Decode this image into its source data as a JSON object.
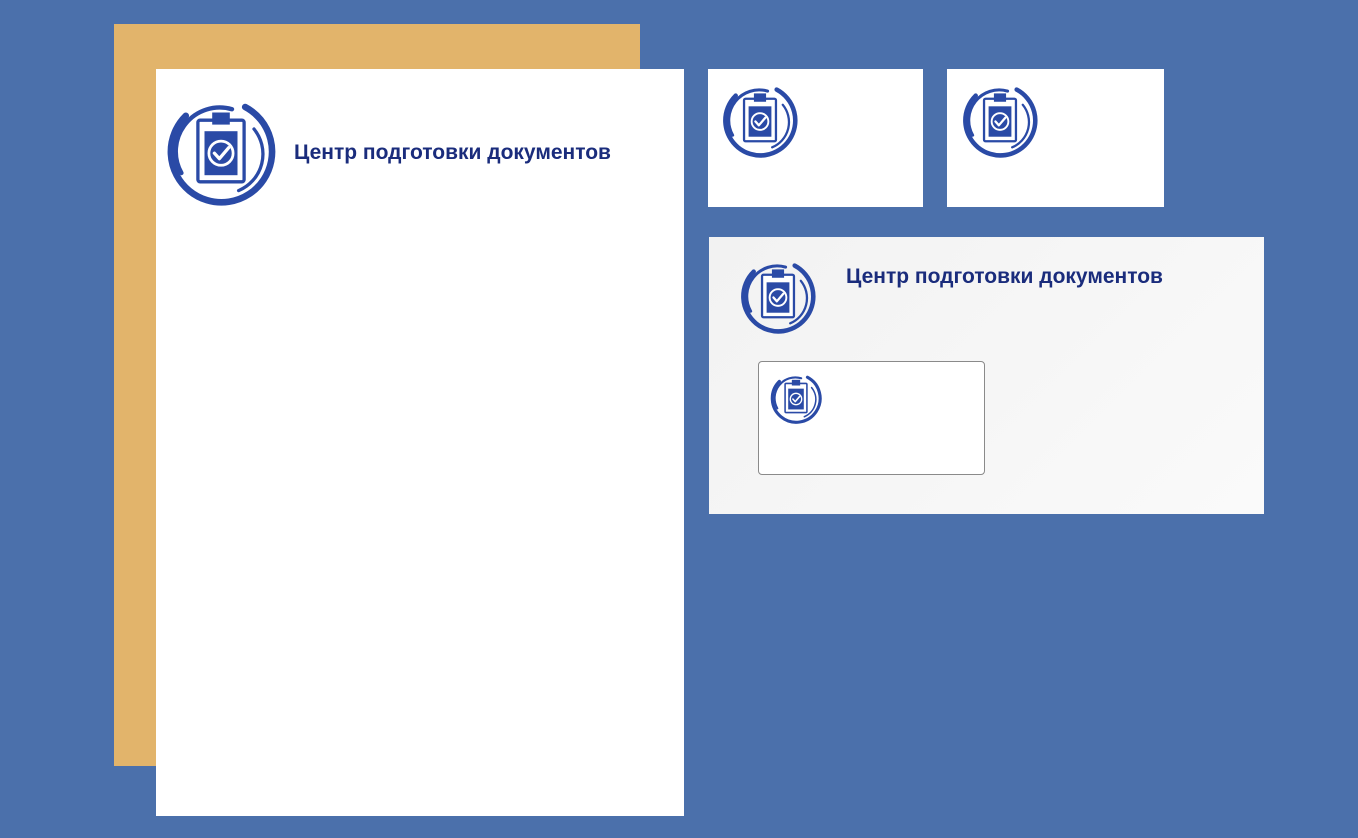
{
  "brand": {
    "name": "Центр подготовки документов",
    "color_primary": "#1a2c7c",
    "color_logo": "#2a4aa6"
  },
  "scene": {
    "background_color": "#4b70ab",
    "backing_sheet_color": "#e2b46b"
  },
  "icons": {
    "logo": "clipboard-check-icon"
  }
}
